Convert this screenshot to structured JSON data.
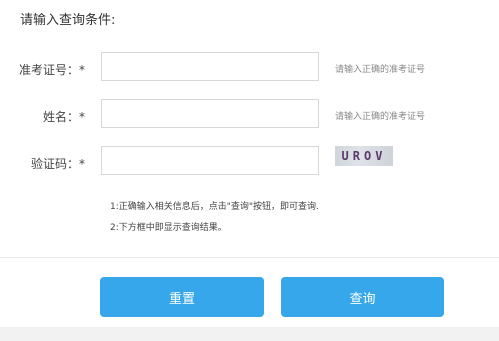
{
  "title": "请输入查询条件:",
  "form": {
    "exam_no": {
      "label": "准考证号：*",
      "value": "",
      "hint": "请输入正确的准考证号"
    },
    "name": {
      "label": "姓名：*",
      "value": "",
      "hint": "请输入正确的准考证号"
    },
    "captcha": {
      "label": "验证码：*",
      "value": "",
      "image_text": "UROV"
    }
  },
  "notes": [
    "1:正确输入相关信息后，点击\"查询\"按钮，即可查询.",
    "2:下方框中即显示查询结果。"
  ],
  "buttons": {
    "reset": "重置",
    "query": "查询"
  },
  "colors": {
    "button_bg": "#35a7ea",
    "input_border": "#d8d8d8"
  }
}
